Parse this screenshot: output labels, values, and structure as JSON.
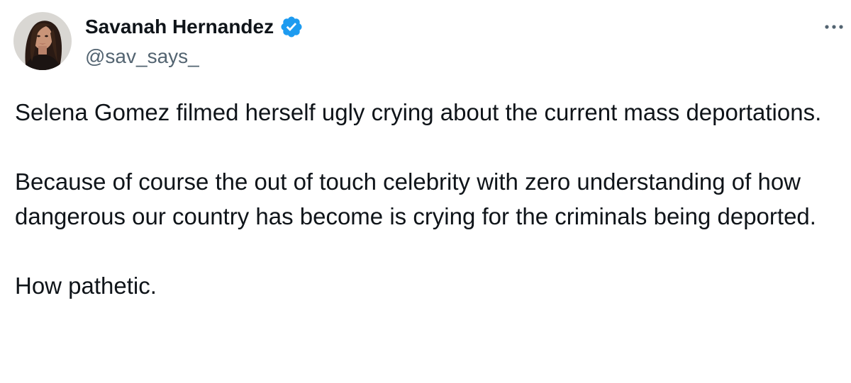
{
  "author": {
    "display_name": "Savanah Hernandez",
    "handle": "@sav_says_",
    "verified": true,
    "avatar": "profile-photo",
    "verified_icon": "verified-badge-icon",
    "accent_color": "#1d9bf0"
  },
  "menu": {
    "icon": "more-options-icon"
  },
  "tweet": {
    "paragraphs": [
      "Selena Gomez filmed herself ugly crying about the current mass deportations.",
      "Because of course the out of touch celebrity with zero understanding of how dangerous our country has become is crying for the criminals being deported.",
      "How pathetic."
    ]
  }
}
